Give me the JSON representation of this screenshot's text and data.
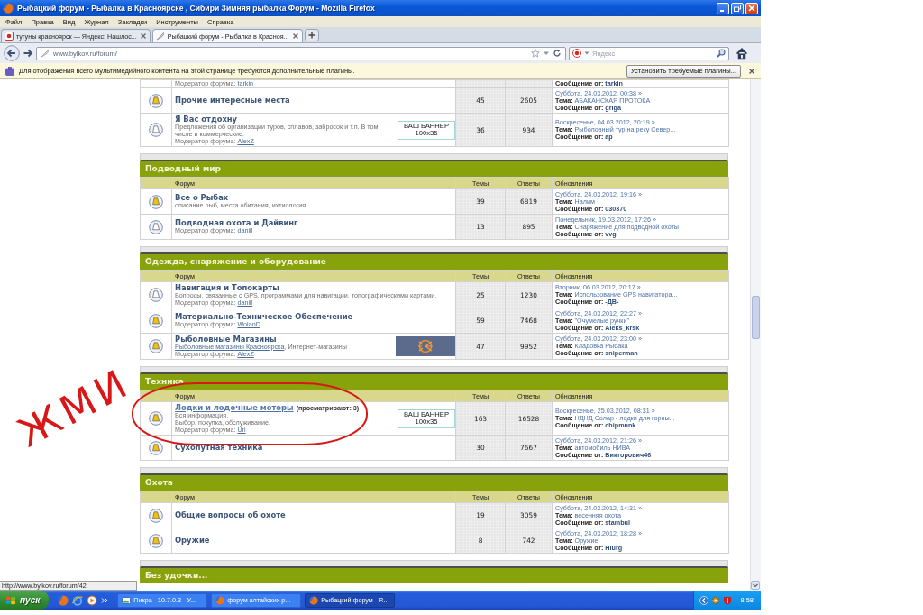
{
  "window": {
    "title": "Рыбацкий форум - Рыбалка в Красноярске , Сибири Зимняя рыбалка Форум - Mozilla Firefox"
  },
  "menu": [
    "Файл",
    "Правка",
    "Вид",
    "Журнал",
    "Закладки",
    "Инструменты",
    "Справка"
  ],
  "tabs": [
    {
      "label": "тугуны красноярск — Яндекс: Нашлос...",
      "kind": "search",
      "selected": false
    },
    {
      "label": "Рыбацкий форум - Рыбалка в Красноя...",
      "kind": "page",
      "selected": true
    }
  ],
  "address_bar": {
    "url": "www.bylkov.ru/forum/"
  },
  "search_bar": {
    "placeholder": "Яндекс"
  },
  "notification": {
    "message": "Для отображения всего мультимедийного контента на этой странице требуются дополнительные плагины.",
    "button": "Установить требуемые плагины..."
  },
  "sections": [
    {
      "rows": [
        {
          "moderator_label": "Модератор форума:",
          "moderator": "tarkin",
          "last_post": {
            "author_label": "Сообщение от:",
            "author": "tarkin"
          }
        },
        {
          "name": "Прочие интересные места",
          "hovered": false,
          "new_posts": true,
          "topics": "45",
          "replies": "2605",
          "last_post": {
            "date": "Суббота, 24.03.2012, 00:38 »",
            "topic_label": "Тема:",
            "topic": "АБАКАНСКАЯ ПРОТОКА",
            "author_label": "Сообщение от:",
            "author": "griga"
          }
        },
        {
          "name": "Я Вас отдохну",
          "hovered": false,
          "new_posts": false,
          "description": [
            {
              "text": "Предложения об организации туров, сплавов, забросок и т.п. В том числе и коммерческие."
            }
          ],
          "moderator_label": "Модератор форума:",
          "moderator": "AlexZ",
          "banner": {
            "kind": "text",
            "lines": [
              "ВАШ БАННЕР",
              "100x35"
            ]
          },
          "topics": "36",
          "replies": "934",
          "last_post": {
            "date": "Воскресенье, 04.03.2012, 20:19 »",
            "topic_label": "Тема:",
            "topic": "Рыболовный тур на реку Север...",
            "author_label": "Сообщение от:",
            "author": "ap"
          }
        }
      ]
    },
    {
      "title": "Подводный мир",
      "columns": [
        "Форум",
        "Темы",
        "Ответы",
        "Обновления"
      ],
      "rows": [
        {
          "name": "Все о Рыбах",
          "hovered": false,
          "new_posts": true,
          "description": [
            {
              "text": "описание рыб, места обитания, ихтиология"
            }
          ],
          "topics": "39",
          "replies": "6819",
          "last_post": {
            "date": "Суббота, 24.03.2012, 19:16 »",
            "topic_label": "Тема:",
            "topic": "Налим",
            "author_label": "Сообщение от:",
            "author": "030370"
          }
        },
        {
          "name": "Подводная охота и Дайвинг",
          "hovered": false,
          "new_posts": false,
          "moderator_label": "Модератор форума:",
          "moderator": "daniil",
          "topics": "13",
          "replies": "895",
          "last_post": {
            "date": "Понедельник, 19.03.2012, 17:26 »",
            "topic_label": "Тема:",
            "topic": "Снаряжение для подводной охоты",
            "author_label": "Сообщение от:",
            "author": "vvg"
          }
        }
      ]
    },
    {
      "title": "Одежда, снаряжение и оборудование",
      "columns": [
        "Форум",
        "Темы",
        "Ответы",
        "Обновления"
      ],
      "rows": [
        {
          "name": "Навигация и Топокарты",
          "hovered": false,
          "new_posts": false,
          "description": [
            {
              "text": "Вопросы, связанные с GPS, программами для навигации, топографическими картами."
            }
          ],
          "moderator_label": "Модератор форума:",
          "moderator": "daniil",
          "topics": "25",
          "replies": "1230",
          "last_post": {
            "date": "Вторник, 06.03.2012, 20:17 »",
            "topic_label": "Тема:",
            "topic": "Использование GPS навигатора...",
            "author_label": "Сообщение от:",
            "author": "-ДВ-"
          }
        },
        {
          "name": "Материально-Техническое Обеспечение",
          "hovered": false,
          "new_posts": true,
          "moderator_label": "Модератор форума:",
          "moderator": "WolanD",
          "topics": "59",
          "replies": "7468",
          "last_post": {
            "date": "Суббота, 24.03.2012, 22:27 »",
            "topic_label": "Тема:",
            "topic": "\"Очумелые ручки\"",
            "author_label": "Сообщение от:",
            "author": "Aleks_krsk"
          }
        },
        {
          "name": "Рыболовные Магазины",
          "hovered": false,
          "new_posts": true,
          "description": [
            {
              "link": "Рыболовные магазины Красноярска",
              "text": ", Интернет-магазины"
            }
          ],
          "moderator_label": "Модератор форума:",
          "moderator": "AlexZ",
          "banner": {
            "kind": "image"
          },
          "topics": "47",
          "replies": "9952",
          "last_post": {
            "date": "Суббота, 24.03.2012, 23:00 »",
            "topic_label": "Тема:",
            "topic": "Кладовка Рыбака",
            "author_label": "Сообщение от:",
            "author": "sniperman"
          }
        }
      ]
    },
    {
      "title": "Техника",
      "columns": [
        "Форум",
        "Темы",
        "Ответы",
        "Обновления"
      ],
      "rows": [
        {
          "name": "Лодки и лодочные моторы",
          "viewers": "(просматривают: 3)",
          "hovered": true,
          "new_posts": true,
          "description": [
            {
              "text": "Вся информация."
            },
            {
              "text": "Выбор, покупка, обслуживание."
            }
          ],
          "moderator_label": "Модератор форума:",
          "moderator": "Uri",
          "banner": {
            "kind": "text",
            "lines": [
              "ВАШ БАННЕР",
              "100x35"
            ]
          },
          "topics": "163",
          "replies": "16528",
          "last_post": {
            "date": "Воскресенье, 25.03.2012, 08:31 »",
            "topic_label": "Тема:",
            "topic": "НДНД Солар - лодки для горны...",
            "author_label": "Сообщение от:",
            "author": "chipmunk"
          }
        },
        {
          "name": "Сухопутная техника",
          "hovered": false,
          "new_posts": true,
          "topics": "30",
          "replies": "7667",
          "last_post": {
            "date": "Суббота, 24.03.2012, 21:26 »",
            "topic_label": "Тема:",
            "topic": "автомобиль НИВА",
            "author_label": "Сообщение от:",
            "author": "Викторович46"
          }
        }
      ]
    },
    {
      "title": "Охота",
      "columns": [
        "Форум",
        "Темы",
        "Ответы",
        "Обновления"
      ],
      "rows": [
        {
          "name": "Общие вопросы об охоте",
          "hovered": false,
          "new_posts": true,
          "topics": "19",
          "replies": "3059",
          "last_post": {
            "date": "Суббота, 24.03.2012, 14:31 »",
            "topic_label": "Тема:",
            "topic": "весенняя охота",
            "author_label": "Сообщение от:",
            "author": "stambul"
          }
        },
        {
          "name": "Оружие",
          "hovered": false,
          "new_posts": true,
          "topics": "8",
          "replies": "742",
          "last_post": {
            "date": "Суббота, 24.03.2012, 18:28 »",
            "topic_label": "Тема:",
            "topic": "Оружие",
            "author_label": "Сообщение от:",
            "author": "Hiurg"
          }
        }
      ]
    },
    {
      "title": "Без удочки..."
    }
  ],
  "annotation": {
    "text": "ЖМИ"
  },
  "status_bar": {
    "url": "http://www.bylkov.ru/forum/42"
  },
  "taskbar": {
    "start": "пуск",
    "tasks": [
      {
        "label": "Пикра - 10.7.0.3 - У...",
        "kind": "viewer",
        "selected": false
      },
      {
        "label": "форум алтайских р...",
        "kind": "browser",
        "selected": false
      },
      {
        "label": "Рыбацкий форум - Р...",
        "kind": "browser",
        "selected": true
      }
    ],
    "clock": "8:58"
  }
}
